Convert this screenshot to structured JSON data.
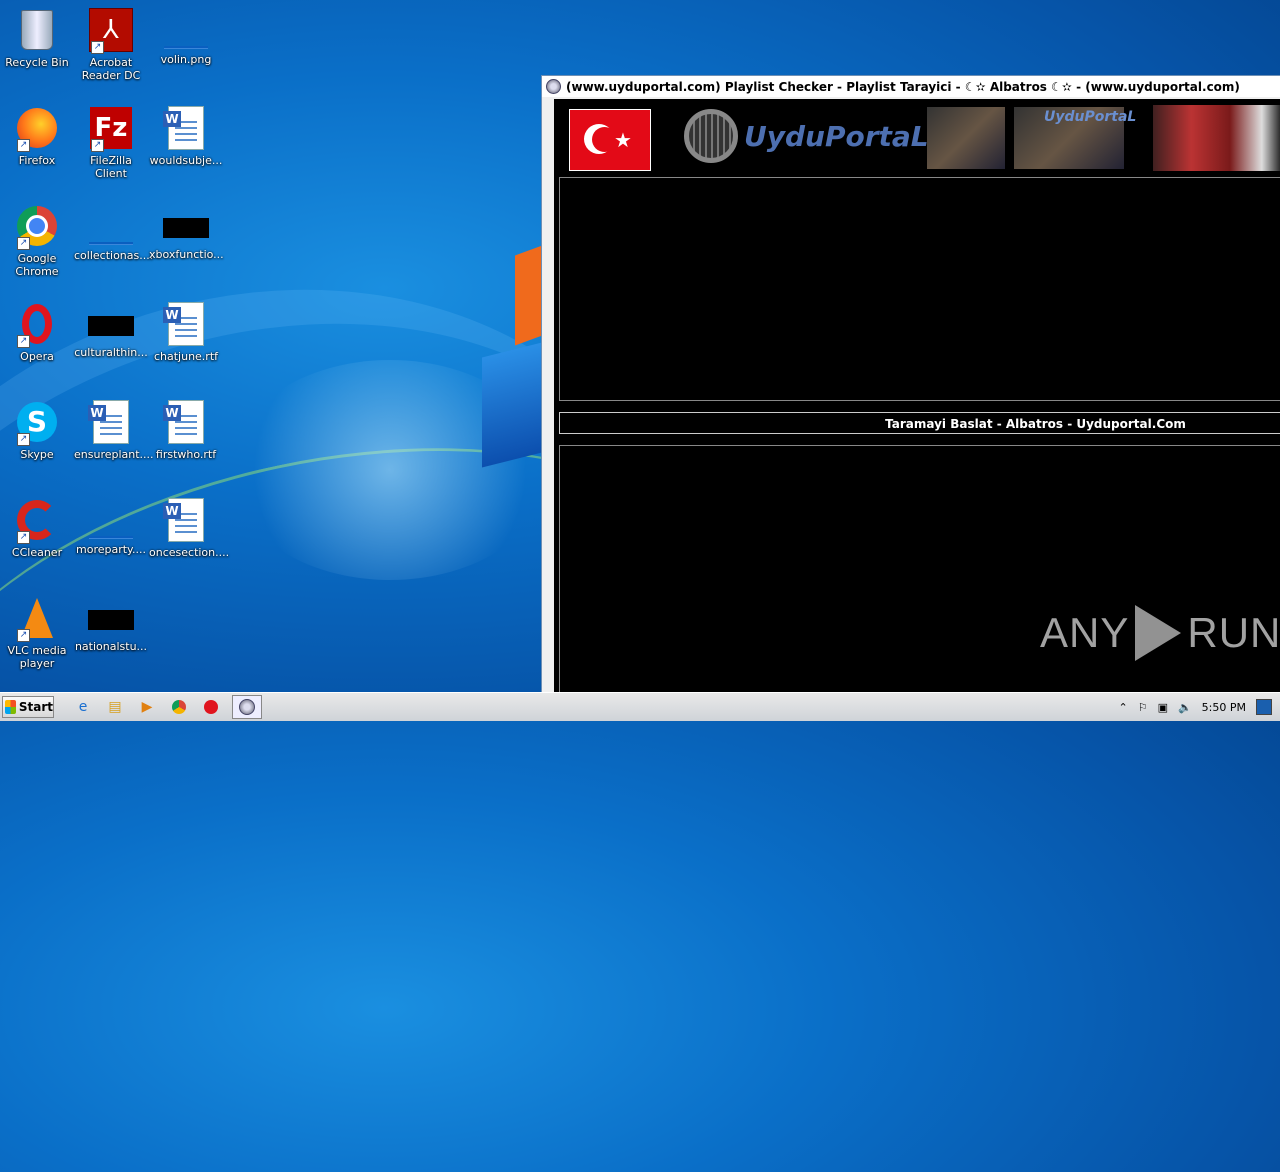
{
  "desktop": {
    "icons": [
      {
        "label": "Recycle Bin"
      },
      {
        "label": "Acrobat Reader DC"
      },
      {
        "label": "volin.png"
      },
      {
        "label": "Firefox"
      },
      {
        "label": "FileZilla Client"
      },
      {
        "label": "wouldsubje..."
      },
      {
        "label": "Google Chrome"
      },
      {
        "label": "collectionas...."
      },
      {
        "label": "xboxfunctio..."
      },
      {
        "label": "Opera"
      },
      {
        "label": "culturalthin..."
      },
      {
        "label": "chatjune.rtf"
      },
      {
        "label": "Skype"
      },
      {
        "label": "ensureplant...."
      },
      {
        "label": "firstwho.rtf"
      },
      {
        "label": "CCleaner"
      },
      {
        "label": "moreparty...."
      },
      {
        "label": "oncesection...."
      },
      {
        "label": "VLC media player"
      },
      {
        "label": "nationalstu..."
      }
    ]
  },
  "window": {
    "title": "(www.uyduportal.com) Playlist Checker - Playlist Tarayici - ☾✫ Albatros ☾✫ - (www.uyduportal.com)",
    "logo_text": "UyduPortaL",
    "small_logo_text": "UyduPortaL",
    "scan_button": "Taramayi Baslat - Albatros - Uyduportal.Com"
  },
  "watermark": {
    "left": "ANY",
    "right": "RUN"
  },
  "taskbar": {
    "start_label": "Start",
    "clock": "5:50 PM"
  }
}
